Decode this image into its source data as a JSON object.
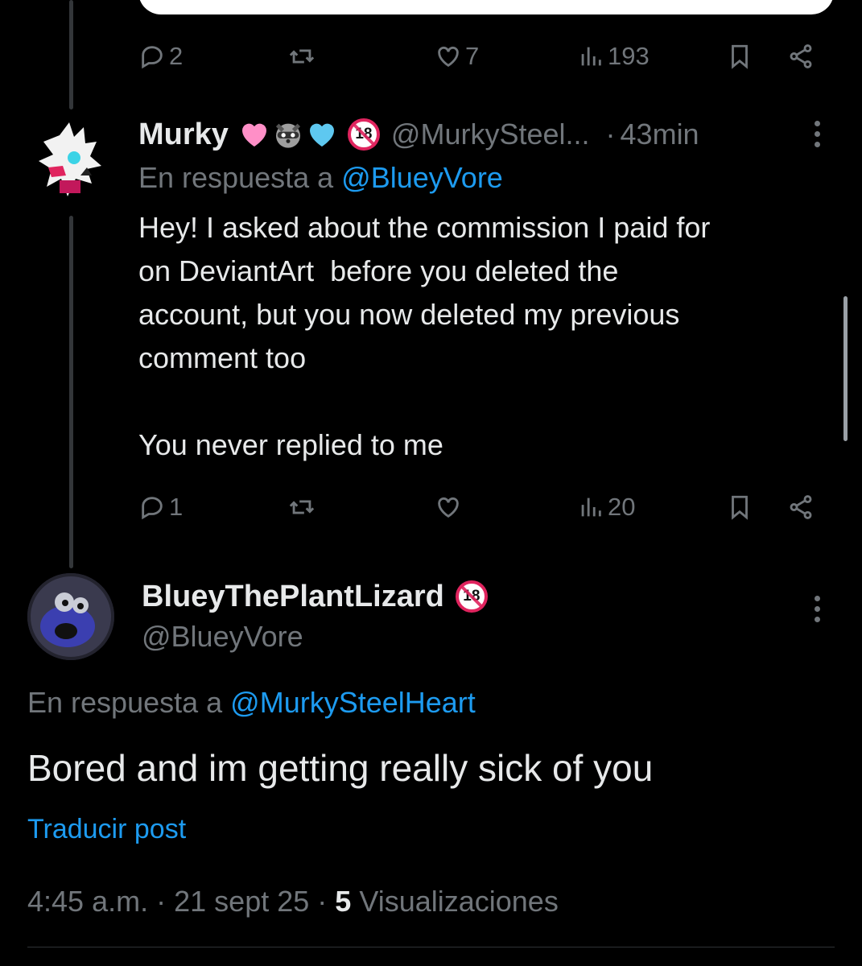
{
  "top_post": {
    "stats": {
      "replies": "2",
      "likes": "7",
      "views": "193"
    }
  },
  "reply_post": {
    "display_name": "Murky",
    "handle": "@MurkySteel...",
    "time_sep": "·",
    "time": "43min",
    "in_reply_prefix": "En respuesta a",
    "in_reply_handle": "@BlueyVore",
    "text": "Hey! I asked about the commission I paid for\non DeviantArt  before you deleted the\naccount, but you now deleted my previous\ncomment too\n\nYou never replied to me",
    "stats": {
      "replies": "1",
      "views": "20"
    },
    "emoji_names": [
      "pink-heart",
      "raccoon",
      "light-blue-heart",
      "no-one-under-18"
    ]
  },
  "main_post": {
    "display_name": "BlueyThePlantLizard",
    "handle": "@BlueyVore",
    "in_reply_prefix": "En respuesta a",
    "in_reply_handle": "@MurkySteelHeart",
    "text": "Bored and im getting really sick of you",
    "translate": "Traducir post",
    "time": "4:45 a.m.",
    "sep1": "·",
    "date": "21 sept 25",
    "sep2": "·",
    "views_count": "5",
    "views_label": "Visualizaciones"
  },
  "badge_text": "18",
  "colors": {
    "accent": "#1d9bf0",
    "muted": "#71767b",
    "background": "#000000",
    "text": "#e7e9ea"
  }
}
